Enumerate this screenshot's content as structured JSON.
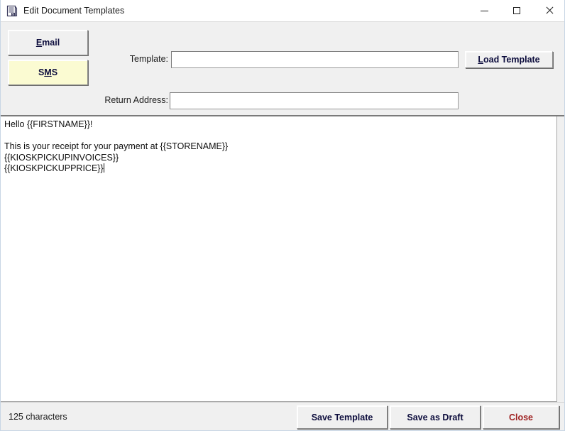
{
  "window": {
    "title": "Edit Document Templates",
    "icon": "document-template-icon",
    "controls": {
      "minimize": "minimize-icon",
      "maximize": "maximize-icon",
      "close": "close-icon"
    }
  },
  "header": {
    "channel_buttons": [
      {
        "label": "Email",
        "accel_index": 0,
        "selected": false
      },
      {
        "label": "SMS",
        "accel_index": 1,
        "selected": true
      }
    ],
    "template": {
      "label": "Template:",
      "value": "",
      "placeholder": ""
    },
    "return_address": {
      "label": "Return Address:",
      "value": "",
      "placeholder": ""
    },
    "load_template_label": "Load Template",
    "load_template_accel_index": 0
  },
  "editor": {
    "content": "Hello {{FIRSTNAME}}!\n\nThis is your receipt for your payment at {{STORENAME}}\n{{KIOSKPICKUPINVOICES}}\n{{KIOSKPICKUPPRICE}}"
  },
  "statusbar": {
    "character_count_text": "125 characters",
    "buttons": [
      {
        "label": "Save Template"
      },
      {
        "label": "Save as Draft"
      },
      {
        "label": "Close"
      }
    ]
  },
  "colors": {
    "window_background": "#f0f0f0",
    "titlebar_background": "#ffffff",
    "selected_button_background": "#fbfbd2",
    "button_text": "#0c0c3c",
    "close_button_text": "#9e2020",
    "editor_background": "#ffffff",
    "window_border": "#c8d6e5"
  }
}
